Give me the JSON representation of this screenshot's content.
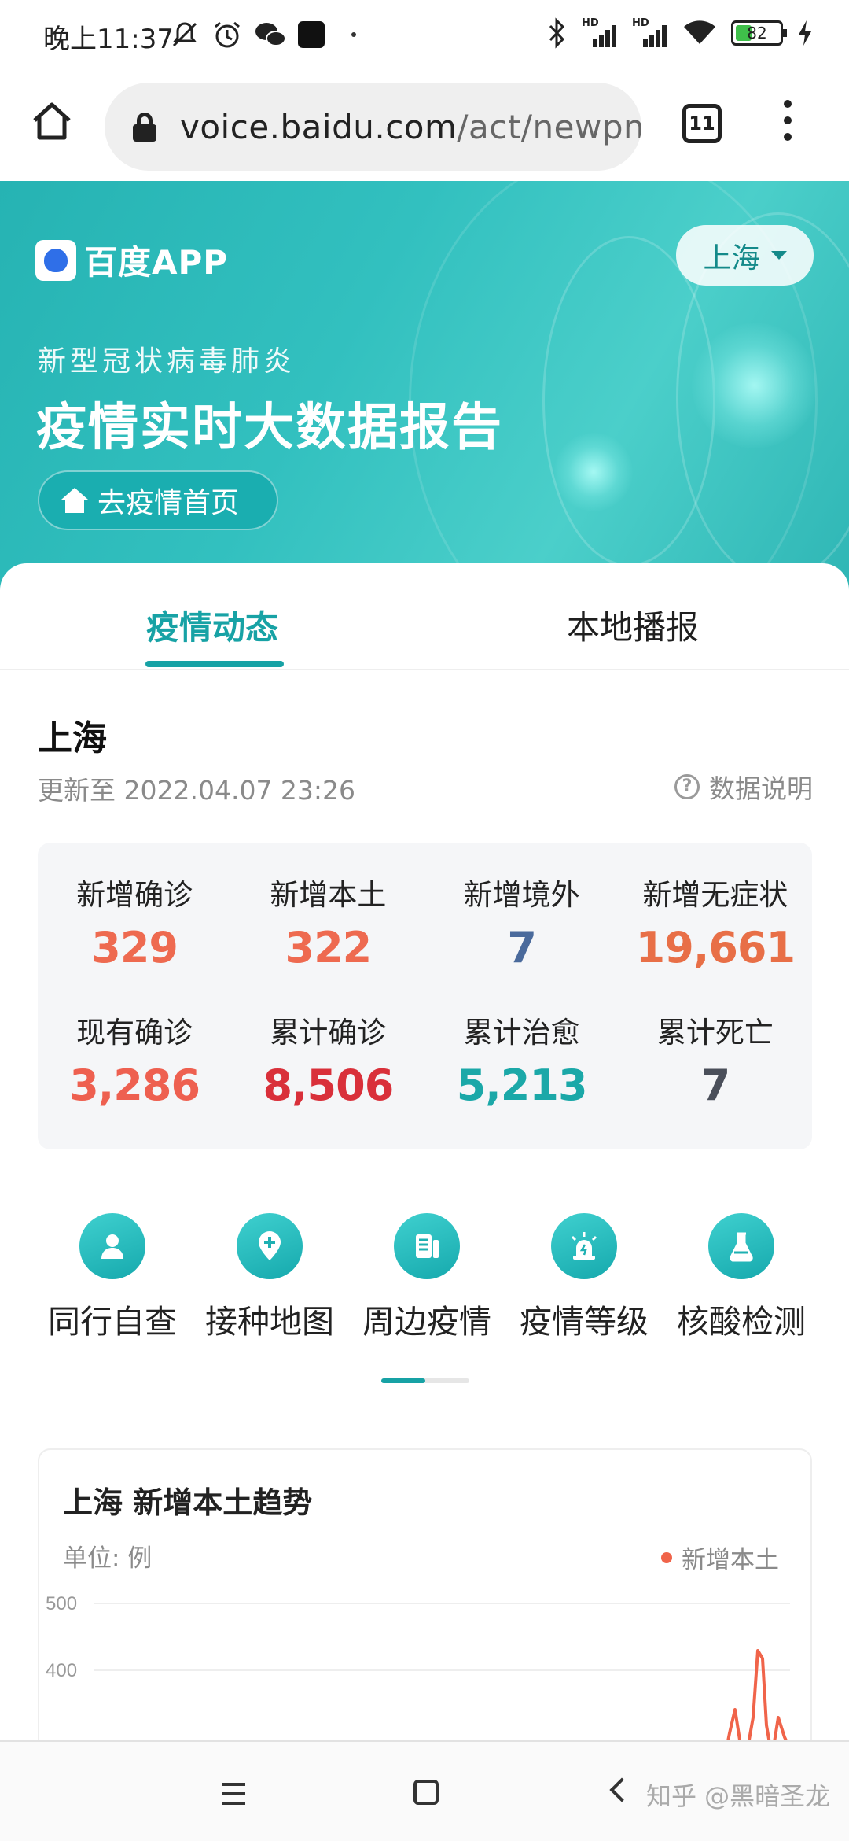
{
  "status_bar": {
    "time": "晚上11:37",
    "battery": "82",
    "icons": [
      "mute-icon",
      "alarm-icon",
      "wechat-icon",
      "app-icon",
      "bluetooth-icon",
      "signal-icon",
      "wifi-icon",
      "battery-icon",
      "charging-icon"
    ],
    "hd_label": "HD"
  },
  "browser": {
    "url_host": "voice.baidu.com",
    "url_path": "/act/newpne",
    "tab_count": "11"
  },
  "banner": {
    "brand": "百度APP",
    "city": "上海",
    "subtitle": "新型冠状病毒肺炎",
    "title": "疫情实时大数据报告",
    "home_link": "去疫情首页"
  },
  "tabs": [
    {
      "label": "疫情动态",
      "active": true
    },
    {
      "label": "本地播报",
      "active": false
    }
  ],
  "region": {
    "name": "上海",
    "updated": "更新至 2022.04.07 23:26",
    "explain": "数据说明"
  },
  "stats": [
    {
      "label": "新增确诊",
      "value": "329",
      "color": "#ee6a50"
    },
    {
      "label": "新增本土",
      "value": "322",
      "color": "#ee6a50"
    },
    {
      "label": "新增境外",
      "value": "7",
      "color": "#4a6a9c"
    },
    {
      "label": "新增无症状",
      "value": "19,661",
      "color": "#e86f47"
    },
    {
      "label": "现有确诊",
      "value": "3,286",
      "color": "#ee6050"
    },
    {
      "label": "累计确诊",
      "value": "8,506",
      "color": "#d9303a"
    },
    {
      "label": "累计治愈",
      "value": "5,213",
      "color": "#1ba8a8"
    },
    {
      "label": "累计死亡",
      "value": "7",
      "color": "#4a4f5a"
    }
  ],
  "quick_links": [
    {
      "label": "同行自查",
      "icon": "person-icon"
    },
    {
      "label": "接种地图",
      "icon": "location-plus-icon"
    },
    {
      "label": "周边疫情",
      "icon": "document-icon"
    },
    {
      "label": "疫情等级",
      "icon": "alarm-light-icon"
    },
    {
      "label": "核酸检测",
      "icon": "flask-icon"
    }
  ],
  "trend": {
    "title": "上海 新增本土趋势",
    "unit": "单位: 例",
    "legend": "新增本土"
  },
  "chart_data": {
    "type": "line",
    "title": "上海 新增本土趋势",
    "ylabel": "单位: 例",
    "series": [
      {
        "name": "新增本土",
        "color": "#f0644a"
      }
    ],
    "yticks": [
      500,
      400
    ],
    "ylim": [
      0,
      500
    ]
  },
  "watermark": "知乎 @黑暗圣龙"
}
